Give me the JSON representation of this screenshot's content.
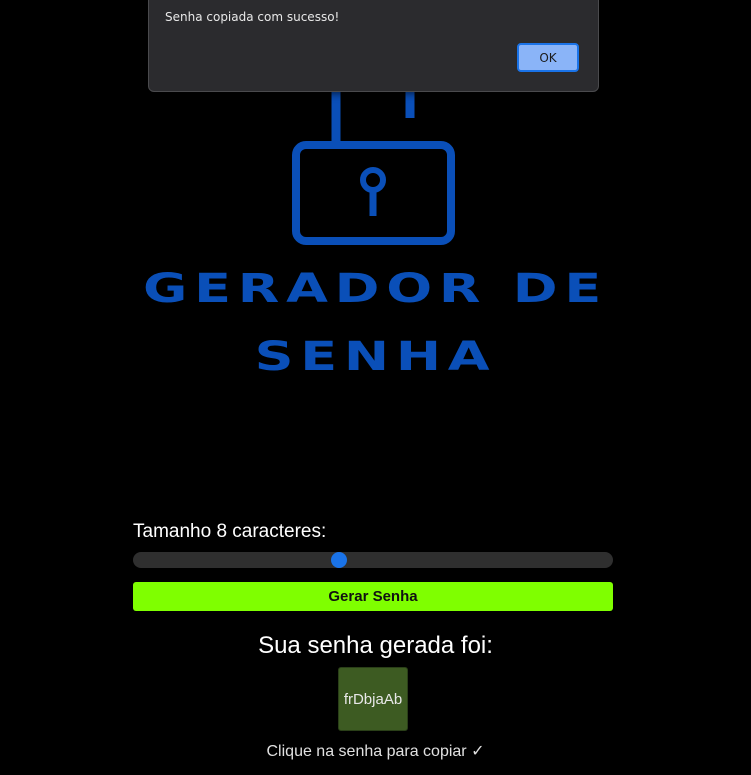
{
  "dialog": {
    "message": "Senha copiada com sucesso!",
    "ok_label": "OK"
  },
  "logo": {
    "line1": "GERADOR DE",
    "line2": "SENHA",
    "icon": "padlock-icon",
    "color": "#0a4fb8"
  },
  "controls": {
    "size_label": "Tamanho 8 caracteres:",
    "slider_fraction": 0.43,
    "slider_thumb_color": "#1a73e8",
    "generate_label": "Gerar Senha",
    "generate_color": "#7fff00"
  },
  "result": {
    "title": "Sua senha gerada foi:",
    "password": "frDbjaAb",
    "hint": "Clique na senha para copiar ✓"
  }
}
